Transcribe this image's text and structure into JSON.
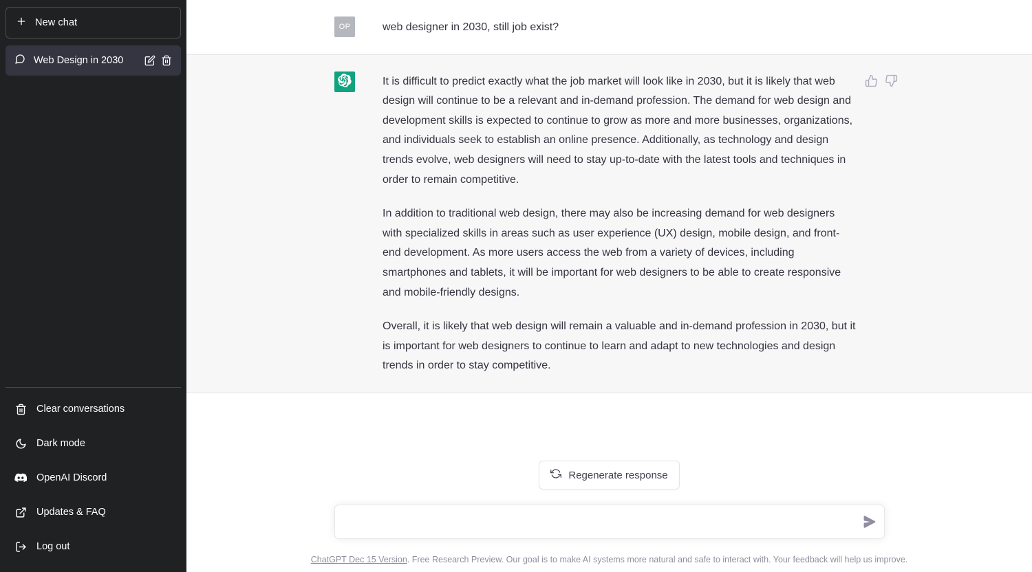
{
  "sidebar": {
    "new_chat": {
      "label": "New chat",
      "icon": "plus-icon"
    },
    "conversations": [
      {
        "title": "Web Design in 2030",
        "icon": "chat-bubble-icon",
        "active": true,
        "edit_icon": "pencil-icon",
        "delete_icon": "trash-icon"
      }
    ],
    "menu": [
      {
        "label": "Clear conversations",
        "icon": "trash-icon"
      },
      {
        "label": "Dark mode",
        "icon": "moon-icon"
      },
      {
        "label": "OpenAI Discord",
        "icon": "discord-icon"
      },
      {
        "label": "Updates & FAQ",
        "icon": "external-link-icon"
      },
      {
        "label": "Log out",
        "icon": "logout-icon"
      }
    ],
    "background_color": "#202123",
    "active_item_color": "#343541"
  },
  "conversation": {
    "messages": [
      {
        "role": "user",
        "avatar_initials": "OP",
        "avatar_color": "#b4b7bd",
        "paragraphs": [
          "web designer in 2030, still job exist?"
        ]
      },
      {
        "role": "assistant",
        "avatar_icon": "openai-logo-icon",
        "avatar_color": "#10a37f",
        "paragraphs": [
          "It is difficult to predict exactly what the job market will look like in 2030, but it is likely that web design will continue to be a relevant and in-demand profession. The demand for web design and development skills is expected to continue to grow as more and more businesses, organizations, and individuals seek to establish an online presence. Additionally, as technology and design trends evolve, web designers will need to stay up-to-date with the latest tools and techniques in order to remain competitive.",
          "In addition to traditional web design, there may also be increasing demand for web designers with specialized skills in areas such as user experience (UX) design, mobile design, and front-end development. As more users access the web from a variety of devices, including smartphones and tablets, it will be important for web designers to be able to create responsive and mobile-friendly designs.",
          "Overall, it is likely that web design will remain a valuable and in-demand profession in 2030, but it is important for web designers to continue to learn and adapt to new technologies and design trends in order to stay competitive."
        ],
        "feedback": {
          "thumbs_up_icon": "thumbs-up-icon",
          "thumbs_down_icon": "thumbs-down-icon"
        }
      }
    ]
  },
  "composer": {
    "regenerate_label": "Regenerate response",
    "regenerate_icon": "refresh-icon",
    "input_value": "",
    "input_placeholder": "",
    "send_icon": "send-arrow-icon"
  },
  "footer": {
    "version_link": "ChatGPT Dec 15 Version",
    "note": ". Free Research Preview. Our goal is to make AI systems more natural and safe to interact with. Your feedback will help us improve."
  }
}
